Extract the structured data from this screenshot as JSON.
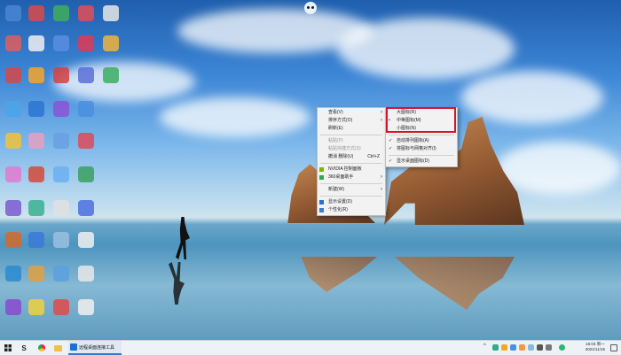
{
  "context_menu": {
    "items": [
      {
        "label": "查看(V)",
        "submenu": true
      },
      {
        "label": "排序方式(O)",
        "submenu": true
      },
      {
        "label": "刷新(E)"
      },
      {
        "separator": true
      },
      {
        "label": "粘贴(P)",
        "disabled": true
      },
      {
        "label": "粘贴快捷方式(S)",
        "disabled": true
      },
      {
        "label": "撤消 删除(U)",
        "shortcut": "Ctrl+Z"
      },
      {
        "separator": true
      },
      {
        "label": "NVIDIA 控制面板",
        "icon": "nvidia-icon",
        "icon_color": "#76b900"
      },
      {
        "label": "360桌面助手",
        "submenu": true,
        "icon": "360-icon",
        "icon_color": "#2fa84f"
      },
      {
        "separator": true
      },
      {
        "label": "新建(W)",
        "submenu": true
      },
      {
        "separator": true
      },
      {
        "label": "显示设置(D)",
        "icon": "display-icon",
        "icon_color": "#2a6fd1"
      },
      {
        "label": "个性化(R)",
        "icon": "personalize-icon",
        "icon_color": "#3a7bd5"
      }
    ]
  },
  "view_submenu": {
    "items": [
      {
        "label": "大图标(R)"
      },
      {
        "label": "中等图标(M)",
        "selected": true
      },
      {
        "label": "小图标(N)"
      },
      {
        "separator": true
      },
      {
        "label": "自动排列图标(A)",
        "checked": true
      },
      {
        "label": "将图标与网格对齐(I)",
        "checked": true
      },
      {
        "separator": true
      },
      {
        "label": "显示桌面图标(D)",
        "checked": true
      }
    ]
  },
  "taskbar": {
    "app_label": "远程桌面连接工具",
    "clock_time": "16:03 周一",
    "clock_date": "2021/11/15"
  },
  "colors": {
    "highlight_border": "#d9142a",
    "taskbar_bg": "#eef2f6"
  }
}
